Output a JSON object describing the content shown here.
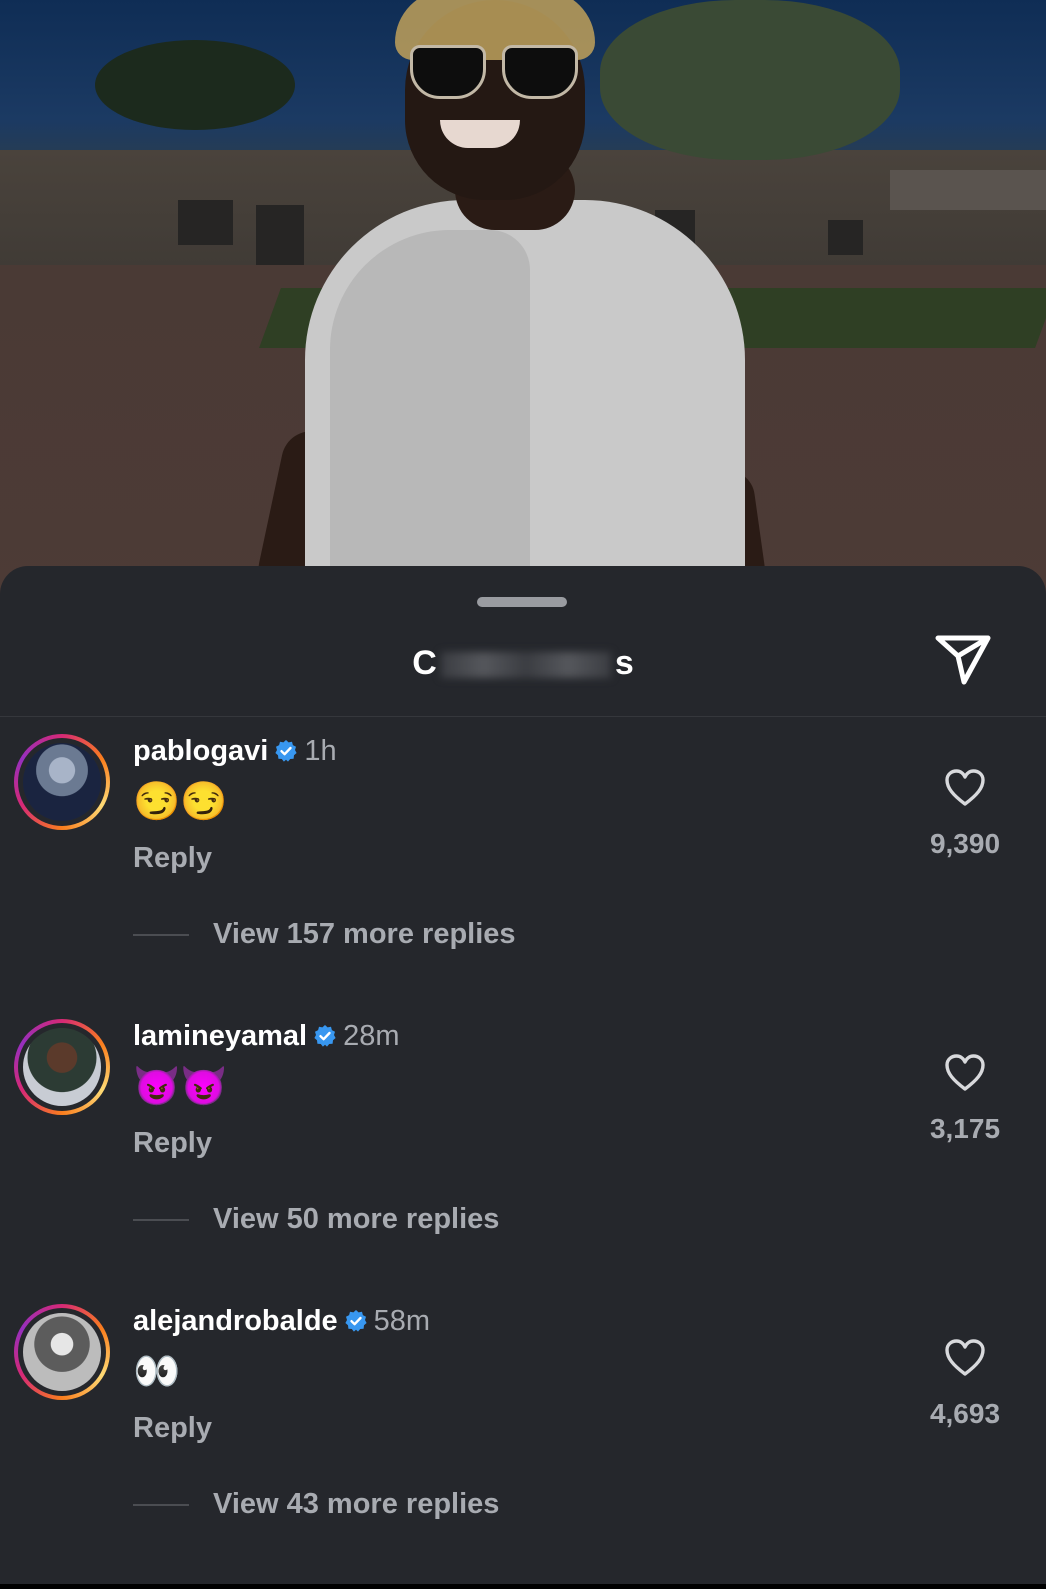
{
  "sheet": {
    "title_prefix": "C",
    "title_suffix": "s",
    "share_icon": "send-icon"
  },
  "comments": [
    {
      "username": "pablogavi",
      "verified": true,
      "time": "1h",
      "text": "😏😏",
      "reply_label": "Reply",
      "likes": "9,390",
      "more_replies": "View 157 more replies"
    },
    {
      "username": "lamineyamal",
      "verified": true,
      "time": "28m",
      "text": "😈😈",
      "reply_label": "Reply",
      "likes": "3,175",
      "more_replies": "View 50 more replies"
    },
    {
      "username": "alejandrobalde",
      "verified": true,
      "time": "58m",
      "text": "👀",
      "reply_label": "Reply",
      "likes": "4,693",
      "more_replies": "View 43 more replies"
    }
  ],
  "colors": {
    "sheet_bg": "#25272c",
    "muted_text": "#a8abb1",
    "verified_blue": "#3897f0"
  }
}
